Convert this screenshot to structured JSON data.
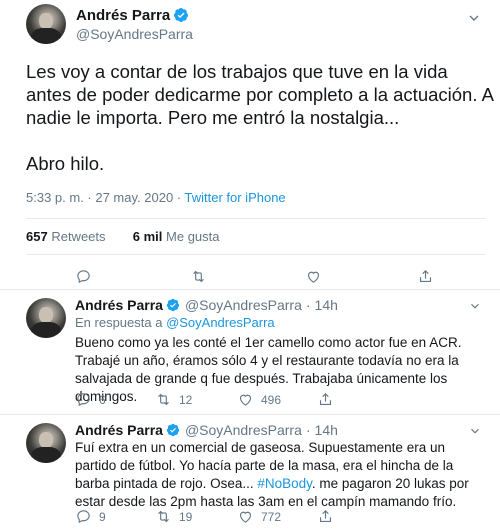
{
  "main": {
    "display_name": "Andrés Parra",
    "handle": "@SoyAndresParra",
    "text_p1": "Les voy a contar de los trabajos que tuve en la vida antes de poder dedicarme por completo a la actuación. A nadie le importa. Pero me entró la nostalgia...",
    "text_p2": "Abro hilo.",
    "time": "5:33 p. m. · 27 may. 2020 · ",
    "source": "Twitter for iPhone",
    "retweets_count": "657",
    "retweets_label": "Retweets",
    "likes_count": "6 mil",
    "likes_label": "Me gusta"
  },
  "replies": [
    {
      "display_name": "Andrés Parra",
      "handle": "@SoyAndresParra",
      "time": "14h",
      "reply_prefix": "En respuesta a ",
      "reply_to": "@SoyAndresParra",
      "text": "Bueno como ya les conté el 1er camello como actor fue en ACR. Trabajé un año, éramos sólo 4 y el restaurante todavía no era la salvajada de grande q fue después. Trabajaba únicamente los domingos.",
      "replies": "6",
      "retweets": "12",
      "likes": "496"
    },
    {
      "display_name": "Andrés Parra",
      "handle": "@SoyAndresParra",
      "time": "14h",
      "text_before": "Fuí extra en un comercial de gaseosa. Supuestamente era un partido de fútbol. Yo hacía parte de la masa, era el hincha de la barba pintada de rojo. Osea... ",
      "hashtag": "#NoBody",
      "text_after": ". me pagaron 20 lukas por estar desde las 2pm hasta las 3am en el campín mamando frío.",
      "replies": "9",
      "retweets": "19",
      "likes": "772"
    }
  ],
  "icons": {
    "verified": "verified-badge-icon",
    "chevron": "chevron-down-icon",
    "reply": "reply-icon",
    "retweet": "retweet-icon",
    "like": "heart-icon",
    "share": "share-icon"
  },
  "colors": {
    "accent": "#1b95e0",
    "muted": "#657786",
    "text": "#14171a",
    "border": "#e6ecf0"
  }
}
